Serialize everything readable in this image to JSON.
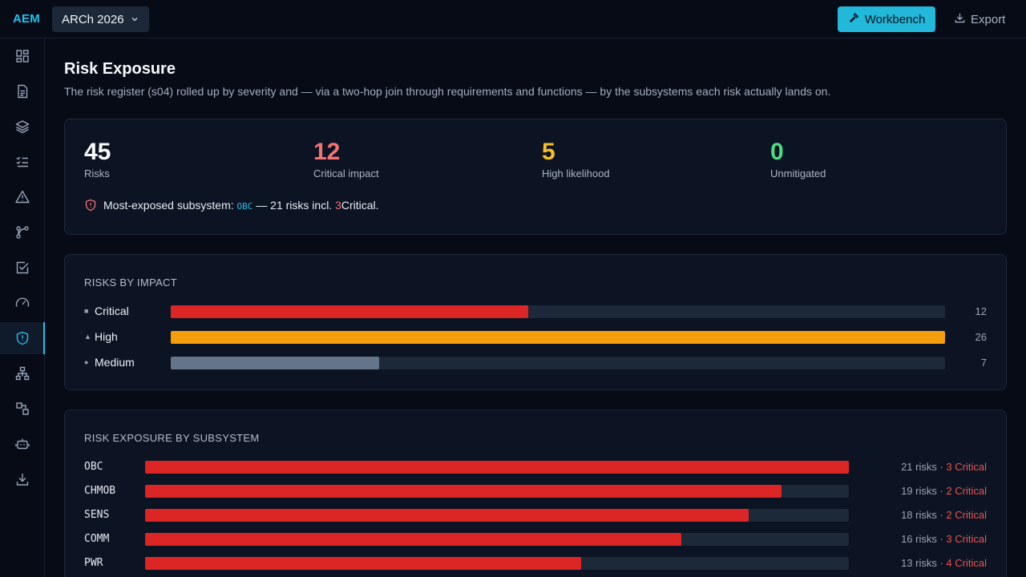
{
  "brand": "AEM",
  "project": "ARCh 2026",
  "actions": {
    "workbench": "Workbench",
    "export": "Export"
  },
  "sidebar": [
    "dashboard-icon",
    "document-icon",
    "layers-icon",
    "checklist-icon",
    "warning-icon",
    "branch-icon",
    "check-square-icon",
    "gauge-icon",
    "shield-alert-icon",
    "hierarchy-icon",
    "flow-icon",
    "robot-icon",
    "download-icon"
  ],
  "page": {
    "title": "Risk Exposure",
    "description": "The risk register (s04) rolled up by severity and — via a two-hop join through requirements and functions — by the subsystems each risk actually lands on."
  },
  "stats": [
    {
      "value": "45",
      "label": "Risks",
      "color": "#f8fafc"
    },
    {
      "value": "12",
      "label": "Critical impact",
      "color": "#f87171"
    },
    {
      "value": "5",
      "label": "High likelihood",
      "color": "#fbbf24"
    },
    {
      "value": "0",
      "label": "Unmitigated",
      "color": "#4ade80"
    }
  ],
  "exposed": {
    "prefix": "Most-exposed subsystem:",
    "subsystem": "OBC",
    "mid": "— 21 risks incl.",
    "critical_count": "3",
    "suffix": "Critical."
  },
  "impact": {
    "title": "RISKS BY IMPACT",
    "max": 26,
    "rows": [
      {
        "mark": "■",
        "label": "Critical",
        "count": 12,
        "count_text": "12",
        "color": "#dc2626"
      },
      {
        "mark": "▲",
        "label": "High",
        "count": 26,
        "count_text": "26",
        "color": "#f59e0b"
      },
      {
        "mark": "●",
        "label": "Medium",
        "count": 7,
        "count_text": "7",
        "color": "#64748b"
      }
    ]
  },
  "subsystems": {
    "title": "RISK EXPOSURE BY SUBSYSTEM",
    "max": 21,
    "rows": [
      {
        "name": "OBC",
        "risks": 21,
        "risks_text": "21 risks",
        "critical_text": "3 Critical"
      },
      {
        "name": "CHMOB",
        "risks": 19,
        "risks_text": "19 risks",
        "critical_text": "2 Critical"
      },
      {
        "name": "SENS",
        "risks": 18,
        "risks_text": "18 risks",
        "critical_text": "2 Critical"
      },
      {
        "name": "COMM",
        "risks": 16,
        "risks_text": "16 risks",
        "critical_text": "3 Critical"
      },
      {
        "name": "PWR",
        "risks": 13,
        "risks_text": "13 risks",
        "critical_text": "4 Critical"
      }
    ]
  }
}
